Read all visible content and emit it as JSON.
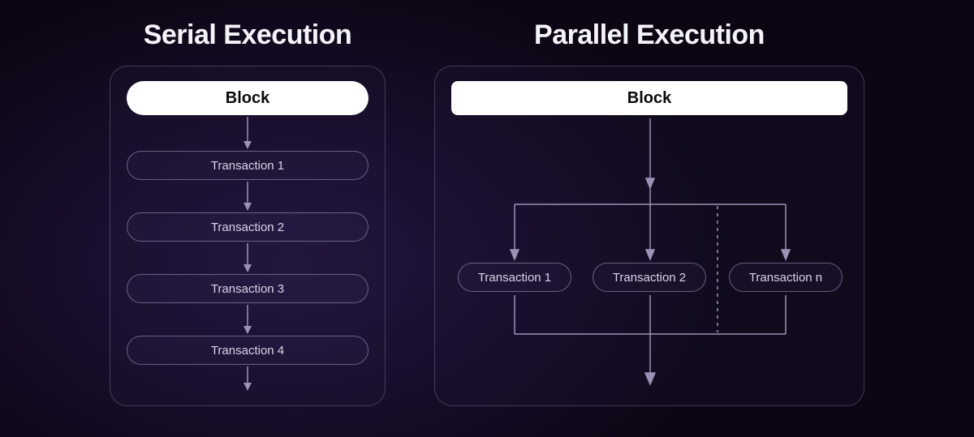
{
  "serial": {
    "title": "Serial Execution",
    "block_label": "Block",
    "transactions": [
      "Transaction 1",
      "Transaction 2",
      "Transaction 3",
      "Transaction 4"
    ]
  },
  "parallel": {
    "title": "Parallel Execution",
    "block_label": "Block",
    "transactions": [
      "Transaction 1",
      "Transaction 2",
      "Transaction n"
    ]
  },
  "colors": {
    "stroke": "#9a93b5"
  }
}
